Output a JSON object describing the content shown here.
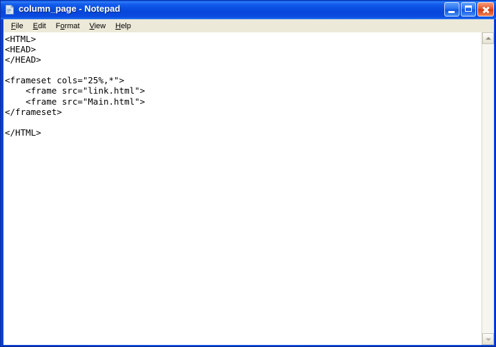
{
  "window": {
    "title": "column_page - Notepad",
    "icon": "notepad-document-icon",
    "frame_color": "#0b4bd8",
    "titlebar_color": "#0a50e0"
  },
  "controls": {
    "minimize_label": "Minimize",
    "maximize_label": "Maximize",
    "close_label": "Close"
  },
  "menu": {
    "items": [
      {
        "accel": "F",
        "rest": "ile"
      },
      {
        "accel": "E",
        "rest": "dit"
      },
      {
        "accel": "o",
        "pre": "F",
        "rest": "rmat"
      },
      {
        "accel": "V",
        "rest": "iew"
      },
      {
        "accel": "H",
        "rest": "elp"
      }
    ],
    "labels": [
      "File",
      "Edit",
      "Format",
      "View",
      "Help"
    ],
    "background": "#ece9d8"
  },
  "editor": {
    "content": "<HTML>\n<HEAD>\n</HEAD>\n\n<frameset cols=\"25%,*\">\n    <frame src=\"link.html\">\n    <frame src=\"Main.html\">\n</frameset>\n\n</HTML>",
    "background": "#ffffff",
    "text_color": "#000000"
  },
  "scrollbar": {
    "up_arrow": "scroll-up-arrow-icon",
    "down_arrow": "scroll-down-arrow-icon",
    "track_color": "#f6f5ee"
  }
}
